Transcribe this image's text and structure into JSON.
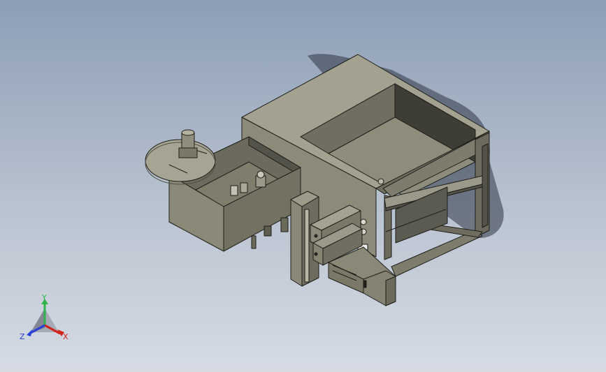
{
  "triad": {
    "x_label": "X",
    "y_label": "Y",
    "z_label": "Z",
    "x_color": "#d0241c",
    "y_color": "#2fb34a",
    "z_color": "#2a3fd6"
  },
  "model": {
    "body_color": "#7c7b6b",
    "body_dark": "#4f4e44",
    "body_light": "#a9a897",
    "edge_color": "#1e1e1a"
  }
}
